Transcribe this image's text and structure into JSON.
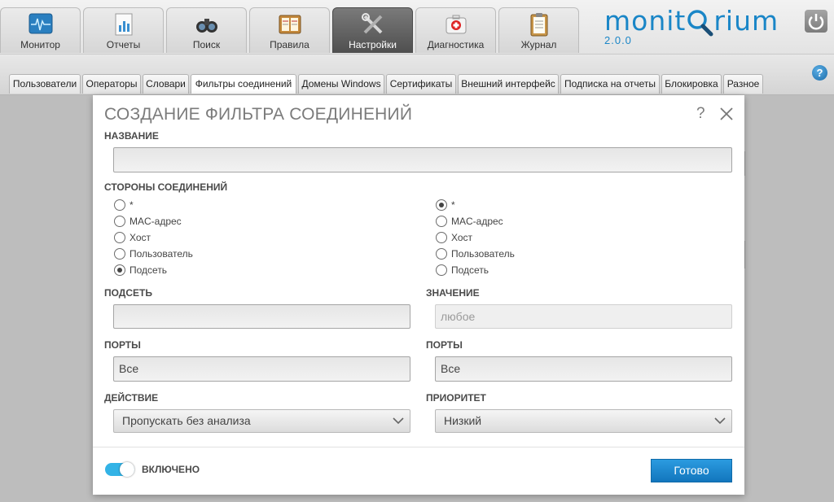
{
  "main_tabs": [
    {
      "label": "Монитор",
      "icon": "monitor-icon",
      "active": false
    },
    {
      "label": "Отчеты",
      "icon": "reports-icon",
      "active": false
    },
    {
      "label": "Поиск",
      "icon": "binoculars-icon",
      "active": false
    },
    {
      "label": "Правила",
      "icon": "rules-book-icon",
      "active": false
    },
    {
      "label": "Настройки",
      "icon": "tools-icon",
      "active": true
    },
    {
      "label": "Диагностика",
      "icon": "first-aid-icon",
      "active": false
    },
    {
      "label": "Журнал",
      "icon": "clipboard-icon",
      "active": false
    }
  ],
  "brand": {
    "logo_pre": "monit",
    "logo_post": "rium",
    "version": "2.0.0",
    "color": "#1a86c7"
  },
  "sub_tabs": [
    {
      "label": "Пользователи"
    },
    {
      "label": "Операторы"
    },
    {
      "label": "Словари"
    },
    {
      "label": "Фильтры соединений",
      "active": true
    },
    {
      "label": "Домены Windows"
    },
    {
      "label": "Сертификаты"
    },
    {
      "label": "Внешний интерфейс"
    },
    {
      "label": "Подписка на отчеты"
    },
    {
      "label": "Блокировка"
    },
    {
      "label": "Разное"
    }
  ],
  "help_symbol": "?",
  "dialog": {
    "title": "СОЗДАНИЕ ФИЛЬТРА СОЕДИНЕНИЙ",
    "help_symbol": "?",
    "name_label": "НАЗВАНИЕ",
    "name_value": "",
    "sides_label": "СТОРОНЫ СОЕДИНЕНИЙ",
    "side_a": {
      "options": [
        "*",
        "MAC-адрес",
        "Хост",
        "Пользователь",
        "Подсеть"
      ],
      "selected": "Подсеть"
    },
    "side_b": {
      "options": [
        "*",
        "MAC-адрес",
        "Хост",
        "Пользователь",
        "Подсеть"
      ],
      "selected": "*"
    },
    "subnet_label": "ПОДСЕТЬ",
    "subnet_value": "",
    "value_label": "ЗНАЧЕНИЕ",
    "value_placeholder": "любое",
    "ports_a_label": "ПОРТЫ",
    "ports_a_value": "Все",
    "ports_b_label": "ПОРТЫ",
    "ports_b_value": "Все",
    "action_label": "ДЕЙСТВИЕ",
    "action_value": "Пропускать без анализа",
    "priority_label": "ПРИОРИТЕТ",
    "priority_value": "Низкий",
    "enabled_label": "ВКЛЮЧЕНО",
    "enabled": true,
    "done_label": "Готово",
    "accent_color": "#1b84cb"
  }
}
